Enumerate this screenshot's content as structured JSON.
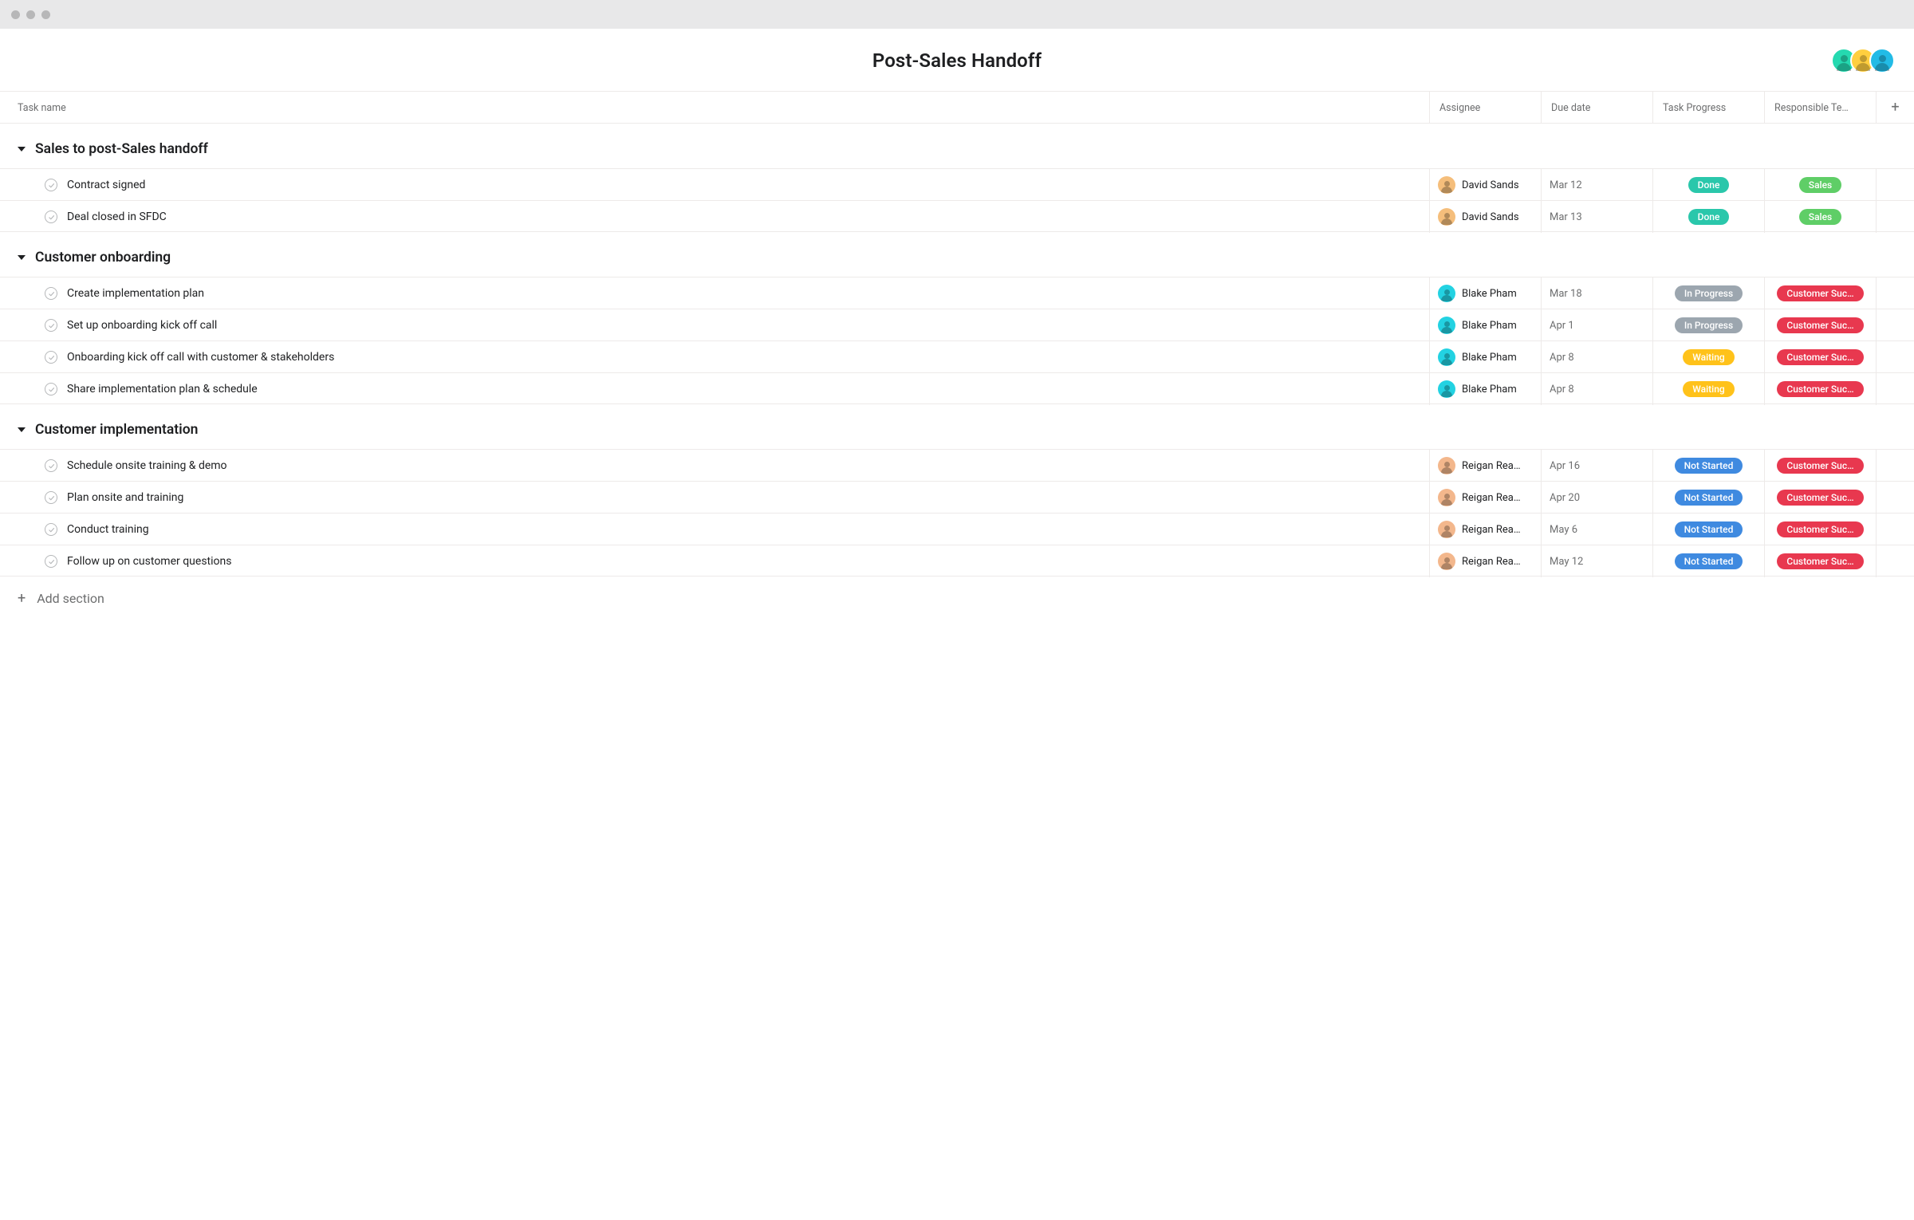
{
  "project": {
    "title": "Post-Sales Handoff"
  },
  "header_avatars": [
    {
      "bg": "#25d9b0"
    },
    {
      "bg": "#ffcf3f"
    },
    {
      "bg": "#22bbe6"
    }
  ],
  "columns": {
    "task_name": "Task name",
    "assignee": "Assignee",
    "due_date": "Due date",
    "task_progress": "Task Progress",
    "responsible_team": "Responsible Te…"
  },
  "pill_colors": {
    "Done": "#2ac7ab",
    "In Progress": "#9ca6af",
    "Waiting": "#ffc21a",
    "Not Started": "#3f8ae0",
    "Sales": "#5fce67",
    "Customer Suc…": "#e8384f"
  },
  "assignee_colors": {
    "David Sands": "#f5be7b",
    "Blake Pham": "#23d2e2",
    "Reigan Rea…": "#f3b78c"
  },
  "sections": [
    {
      "title": "Sales to post-Sales handoff",
      "tasks": [
        {
          "name": "Contract signed",
          "assignee": "David Sands",
          "due": "Mar 12",
          "progress": "Done",
          "team": "Sales"
        },
        {
          "name": "Deal closed in SFDC",
          "assignee": "David Sands",
          "due": "Mar 13",
          "progress": "Done",
          "team": "Sales"
        }
      ]
    },
    {
      "title": "Customer onboarding",
      "tasks": [
        {
          "name": "Create implementation plan",
          "assignee": "Blake Pham",
          "due": "Mar 18",
          "progress": "In Progress",
          "team": "Customer Suc…"
        },
        {
          "name": "Set up onboarding kick off call",
          "assignee": "Blake Pham",
          "due": "Apr 1",
          "progress": "In Progress",
          "team": "Customer Suc…"
        },
        {
          "name": "Onboarding kick off call with customer & stakeholders",
          "assignee": "Blake Pham",
          "due": "Apr 8",
          "progress": "Waiting",
          "team": "Customer Suc…"
        },
        {
          "name": "Share implementation plan & schedule",
          "assignee": "Blake Pham",
          "due": "Apr 8",
          "progress": "Waiting",
          "team": "Customer Suc…"
        }
      ]
    },
    {
      "title": "Customer implementation",
      "tasks": [
        {
          "name": "Schedule onsite training & demo",
          "assignee": "Reigan Rea…",
          "due": "Apr 16",
          "progress": "Not Started",
          "team": "Customer Suc…"
        },
        {
          "name": "Plan onsite and training",
          "assignee": "Reigan Rea…",
          "due": "Apr 20",
          "progress": "Not Started",
          "team": "Customer Suc…"
        },
        {
          "name": "Conduct training",
          "assignee": "Reigan Rea…",
          "due": "May 6",
          "progress": "Not Started",
          "team": "Customer Suc…"
        },
        {
          "name": "Follow up on customer questions",
          "assignee": "Reigan Rea…",
          "due": "May 12",
          "progress": "Not Started",
          "team": "Customer Suc…"
        }
      ]
    }
  ],
  "add_section_label": "Add section"
}
